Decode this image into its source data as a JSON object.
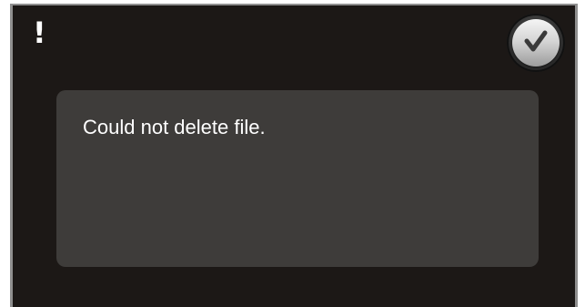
{
  "dialog": {
    "alert_glyph": "!",
    "message": "Could not delete file.",
    "confirm_icon": "check-icon"
  },
  "colors": {
    "background": "#1c1816",
    "panel": "#3e3c3a",
    "text": "#ffffff",
    "frame": "#8f8f8f"
  }
}
